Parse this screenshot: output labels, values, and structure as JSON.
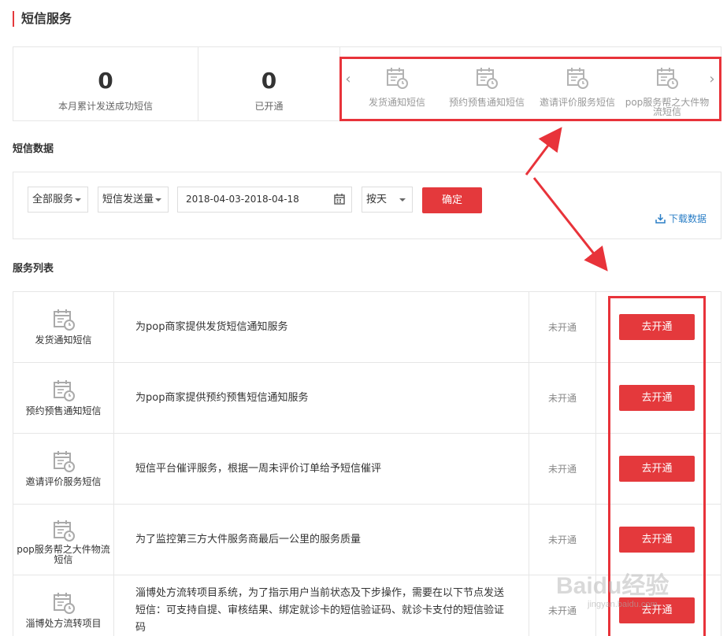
{
  "page_title": "短信服务",
  "stats": [
    {
      "value": "0",
      "label": "本月累计发送成功短信"
    },
    {
      "value": "0",
      "label": "已开通"
    }
  ],
  "carousel": {
    "items": [
      {
        "label": "发货通知短信"
      },
      {
        "label": "预约预售通知短信"
      },
      {
        "label": "邀请评价服务短信"
      },
      {
        "label": "pop服务帮之大件物流短信"
      }
    ]
  },
  "sms_data": {
    "title": "短信数据",
    "service_select": "全部服务",
    "metric_select": "短信发送量",
    "date_range": "2018-04-03-2018-04-18",
    "granularity_select": "按天",
    "confirm_label": "确定",
    "download_label": "下载数据"
  },
  "service_list": {
    "title": "服务列表",
    "rows": [
      {
        "name": "发货通知短信",
        "desc": "为pop商家提供发货短信通知服务",
        "status": "未开通",
        "action": "去开通"
      },
      {
        "name": "预约预售通知短信",
        "desc": "为pop商家提供预约预售短信通知服务",
        "status": "未开通",
        "action": "去开通"
      },
      {
        "name": "邀请评价服务短信",
        "desc": "短信平台催评服务，根据一周未评价订单给予短信催评",
        "status": "未开通",
        "action": "去开通"
      },
      {
        "name": "pop服务帮之大件物流短信",
        "desc": "为了监控第三方大件服务商最后一公里的服务质量",
        "status": "未开通",
        "action": "去开通"
      },
      {
        "name": "淄博处方流转项目",
        "desc": "淄博处方流转项目系统，为了指示用户当前状态及下步操作，需要在以下节点发送短信：可支持自提、审核结果、绑定就诊卡的短信验证码、就诊卡支付的短信验证码",
        "status": "未开通",
        "action": "去开通"
      }
    ]
  },
  "colors": {
    "accent": "#e4393c",
    "highlight": "#e8333a",
    "link": "#2a7ec6"
  },
  "icons": {
    "service": "calendar-clock-icon",
    "date": "calendar-icon",
    "download": "download-icon"
  },
  "watermark": {
    "text": "Baidu经验",
    "sub": "jingyan.baidu.com"
  }
}
